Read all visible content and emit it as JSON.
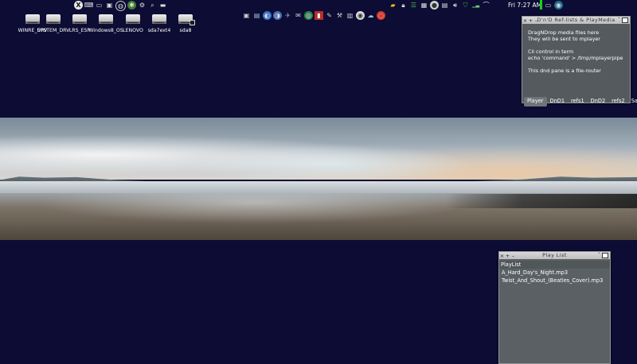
{
  "desktop": {
    "drives": [
      {
        "label": "WINRE_DRV",
        "external": false
      },
      {
        "label": "SYSTEM_DRV",
        "external": false
      },
      {
        "label": "LRS_ESP",
        "external": false
      },
      {
        "label": "Windows8_OS",
        "external": false
      },
      {
        "label": "LENOVO",
        "external": false
      },
      {
        "label": "sda7ext4",
        "external": false
      },
      {
        "label": "sda8",
        "external": true
      }
    ]
  },
  "tray": {
    "left_icons": [
      "x-logo-icon",
      "keyboard-icon",
      "folder-icon",
      "monitor-icon",
      "globe-icon",
      "gear-icon",
      "settings-icon",
      "search-icon",
      "drive-icon"
    ],
    "right_icons": [
      "folder-yellow-icon",
      "lock-icon",
      "network-icon",
      "mixer-icon",
      "disc-icon",
      "chat-icon",
      "volume-icon",
      "shield-icon",
      "wifi-bars-icon",
      "signal-icon"
    ],
    "clock": "Fri 7:27 AM",
    "after_clock_icons": [
      "keyboard-tray-icon",
      "network-tray-icon"
    ]
  },
  "launcher": {
    "icons": [
      "camera-icon",
      "monitor-icon",
      "browser-icon",
      "firefox-icon",
      "bird-icon",
      "mail-icon",
      "terminal-globe-icon",
      "pdf-icon",
      "vector-icon",
      "tools-icon",
      "calculator-icon",
      "dvd-icon",
      "cloud-icon",
      "ubuntu-icon"
    ]
  },
  "dnd_window": {
    "title": "D'n'D Ref-lists & PlayMedia",
    "lines": [
      "DragNDrop media files here",
      "They will be sent to mplayer",
      "",
      "Cli control in term",
      "echo 'command' > /tmp/mplayerpipe",
      "",
      "This dnd pane is a file-router"
    ],
    "tabs": [
      "Player",
      "DnD1",
      "refs1",
      "DnD2",
      "refs2",
      "Save"
    ],
    "active_tab": "Player"
  },
  "playlist_window": {
    "title": "Play List",
    "header": "PlayList",
    "items": [
      "A_Hard_Day's_Night.mp3",
      "Twist_And_Shout_(Beatles_Cover).mp3"
    ]
  },
  "colors": {
    "desktop_bg": "#0c0c34",
    "window_bg": "#555a5e",
    "titlebar": "#d0d0d0",
    "clock_indicator": "#17d317"
  }
}
